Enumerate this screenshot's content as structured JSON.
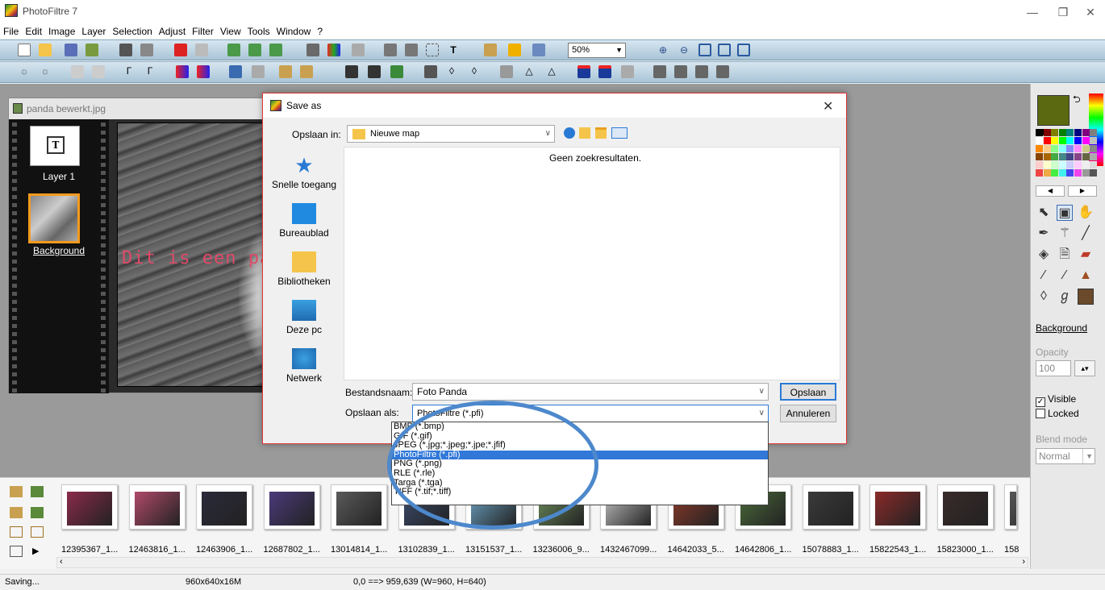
{
  "app": {
    "title": "PhotoFiltre 7"
  },
  "menu": [
    "File",
    "Edit",
    "Image",
    "Layer",
    "Selection",
    "Adjust",
    "Filter",
    "View",
    "Tools",
    "Window",
    "?"
  ],
  "toolbar": {
    "zoom": "50%"
  },
  "document": {
    "title": "panda bewerkt.jpg",
    "layers": [
      "Layer 1",
      "Background"
    ],
    "canvas_text": "Dit is een pan"
  },
  "dialog": {
    "title": "Save as",
    "look_in_label": "Opslaan in:",
    "look_in_value": "Nieuwe map",
    "places": [
      "Snelle toegang",
      "Bureaublad",
      "Bibliotheken",
      "Deze pc",
      "Netwerk"
    ],
    "empty_message": "Geen zoekresultaten.",
    "filename_label": "Bestandsnaam:",
    "filename_value": "Foto Panda",
    "filetype_label": "Opslaan als:",
    "filetype_value": "PhotoFiltre (*.pfi)",
    "save_button": "Opslaan",
    "cancel_button": "Annuleren",
    "filetype_options": [
      "BMP (*.bmp)",
      "GIF (*.gif)",
      "JPEG (*.jpg;*.jpeg;*.jpe;*.jfif)",
      "PhotoFiltre (*.pfi)",
      "PNG (*.png)",
      "RLE (*.rle)",
      "Targa (*.tga)",
      "TIFF (*.tif;*.tiff)"
    ],
    "selected_option_index": 3
  },
  "right_panel": {
    "fg_color": "#5b6a10",
    "layer_name": "Background",
    "opacity_label": "Opacity",
    "opacity_value": "100",
    "visible_label": "Visible",
    "locked_label": "Locked",
    "blend_label": "Blend mode",
    "blend_value": "Normal"
  },
  "browser": {
    "files": [
      "12395367_1...",
      "12463816_1...",
      "12463906_1...",
      "12687802_1...",
      "13014814_1...",
      "13102839_1...",
      "13151537_1...",
      "13236006_9...",
      "1432467099...",
      "14642033_5...",
      "14642806_1...",
      "15078883_1...",
      "15822543_1...",
      "15823000_1...",
      "158"
    ]
  },
  "status": {
    "message": "Saving...",
    "image_info": "960x640x16M",
    "coords": "0,0 ==> 959,639 (W=960, H=640)"
  },
  "colors": {
    "accent": "#3178d8",
    "highlight_ellipse": "#4d88cc",
    "layer_selected": "#f39a1e"
  }
}
